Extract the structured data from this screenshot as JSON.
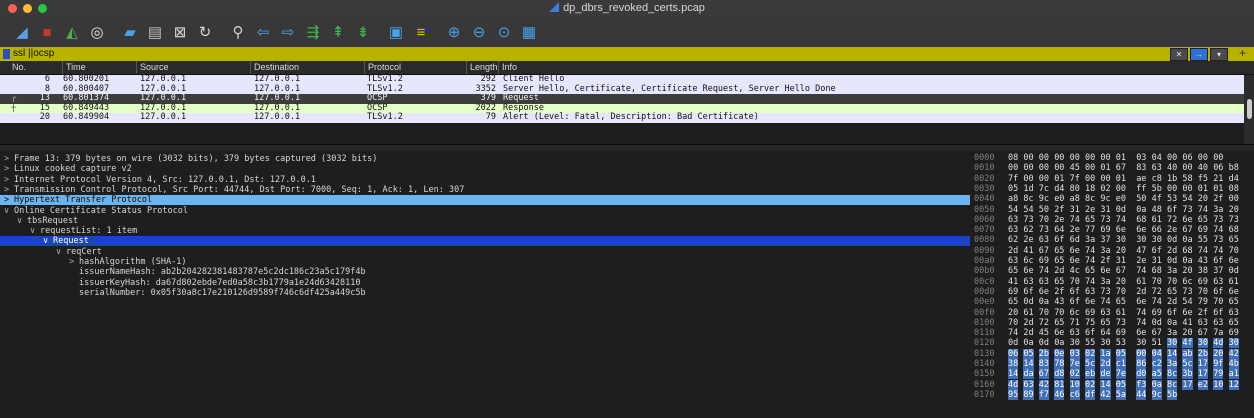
{
  "window": {
    "title": "dp_dbrs_revoked_certs.pcap",
    "light_colors": [
      "#ff5f57",
      "#febc2e",
      "#28c840"
    ]
  },
  "toolbar": {
    "icons": [
      {
        "name": "start-capture-icon",
        "glyph": "◢",
        "color": "#5aa0e8"
      },
      {
        "name": "stop-capture-icon",
        "glyph": "■",
        "color": "#c0392b"
      },
      {
        "name": "restart-capture-icon",
        "glyph": "◭",
        "color": "#4cae4c"
      },
      {
        "name": "capture-options-icon",
        "glyph": "◎",
        "color": "#e6e6e6"
      },
      {
        "name": "open-file-icon",
        "glyph": "▰",
        "color": "#4aa3e8"
      },
      {
        "name": "save-file-icon",
        "glyph": "▤",
        "color": "#bdbdbd"
      },
      {
        "name": "close-file-icon",
        "glyph": "⊠",
        "color": "#d8d8d8"
      },
      {
        "name": "reload-file-icon",
        "glyph": "↻",
        "color": "#d8d8d8"
      },
      {
        "name": "find-packet-icon",
        "glyph": "⚲",
        "color": "#d0d0d0"
      },
      {
        "name": "go-back-icon",
        "glyph": "⇦",
        "color": "#4aa3e8"
      },
      {
        "name": "go-forward-icon",
        "glyph": "⇨",
        "color": "#4aa3e8"
      },
      {
        "name": "go-to-packet-icon",
        "glyph": "⇶",
        "color": "#3fb950"
      },
      {
        "name": "go-first-packet-icon",
        "glyph": "⇞",
        "color": "#3fb950"
      },
      {
        "name": "go-last-packet-icon",
        "glyph": "⇟",
        "color": "#3fb950"
      },
      {
        "name": "autoscroll-icon",
        "glyph": "▣",
        "color": "#4aa3e8"
      },
      {
        "name": "colorize-icon",
        "glyph": "≡",
        "color": "#d7c400"
      },
      {
        "name": "zoom-in-icon",
        "glyph": "⊕",
        "color": "#4aa3e8"
      },
      {
        "name": "zoom-out-icon",
        "glyph": "⊖",
        "color": "#4aa3e8"
      },
      {
        "name": "normal-size-icon",
        "glyph": "⊙",
        "color": "#4aa3e8"
      },
      {
        "name": "resize-columns-icon",
        "glyph": "▦",
        "color": "#4aa3e8"
      }
    ]
  },
  "filter": {
    "value": "ssl ||ocsp",
    "bg_color": "#b7b100"
  },
  "packet_list": {
    "columns": [
      "No.",
      "Time",
      "Source",
      "Destination",
      "Protocol",
      "Length",
      "Info"
    ],
    "rows": [
      {
        "no": "6",
        "time": "60.800201",
        "source": "127.0.0.1",
        "destination": "127.0.0.1",
        "protocol": "TLSv1.2",
        "length": "292",
        "info": "Client Hello",
        "bg": "#e7e6ff",
        "selected": false,
        "marker": ""
      },
      {
        "no": "8",
        "time": "60.800407",
        "source": "127.0.0.1",
        "destination": "127.0.0.1",
        "protocol": "TLSv1.2",
        "length": "3352",
        "info": "Server Hello, Certificate, Certificate Request, Server Hello Done",
        "bg": "#e7e6ff",
        "selected": false,
        "marker": ""
      },
      {
        "no": "13",
        "time": "60.801374",
        "source": "127.0.0.1",
        "destination": "127.0.0.1",
        "protocol": "OCSP",
        "length": "379",
        "info": "Request",
        "bg": "#3d3d3d",
        "selected": true,
        "marker": "┌"
      },
      {
        "no": "15",
        "time": "60.849443",
        "source": "127.0.0.1",
        "destination": "127.0.0.1",
        "protocol": "OCSP",
        "length": "2022",
        "info": "Response",
        "bg": "#e4ffc7",
        "selected": false,
        "marker": "┼"
      },
      {
        "no": "20",
        "time": "60.849904",
        "source": "127.0.0.1",
        "destination": "127.0.0.1",
        "protocol": "TLSv1.2",
        "length": "79",
        "info": "Alert (Level: Fatal, Description: Bad Certificate)",
        "bg": "#e7e6ff",
        "selected": false,
        "marker": ""
      }
    ]
  },
  "details": [
    {
      "indent": 0,
      "arrow": ">",
      "text": "Frame 13: 379 bytes on wire (3032 bits), 379 bytes captured (3032 bits)",
      "hl": ""
    },
    {
      "indent": 0,
      "arrow": ">",
      "text": "Linux cooked capture v2",
      "hl": ""
    },
    {
      "indent": 0,
      "arrow": ">",
      "text": "Internet Protocol Version 4, Src: 127.0.0.1, Dst: 127.0.0.1",
      "hl": ""
    },
    {
      "indent": 0,
      "arrow": ">",
      "text": "Transmission Control Protocol, Src Port: 44744, Dst Port: 7000, Seq: 1, Ack: 1, Len: 307",
      "hl": ""
    },
    {
      "indent": 0,
      "arrow": ">",
      "text": "Hypertext Transfer Protocol",
      "hl": "light"
    },
    {
      "indent": 0,
      "arrow": "∨",
      "text": "Online Certificate Status Protocol",
      "hl": ""
    },
    {
      "indent": 1,
      "arrow": "∨",
      "text": "tbsRequest",
      "hl": ""
    },
    {
      "indent": 2,
      "arrow": "∨",
      "text": "requestList: 1 item",
      "hl": ""
    },
    {
      "indent": 3,
      "arrow": "∨",
      "text": "Request",
      "hl": "dark"
    },
    {
      "indent": 4,
      "arrow": "∨",
      "text": "reqCert",
      "hl": ""
    },
    {
      "indent": 5,
      "arrow": ">",
      "text": "hashAlgorithm (SHA-1)",
      "hl": ""
    },
    {
      "indent": 5,
      "arrow": "",
      "text": "issuerNameHash: ab2b204282381483787e5c2dc186c23a5c179f4b",
      "hl": ""
    },
    {
      "indent": 5,
      "arrow": "",
      "text": "issuerKeyHash: da67d802ebde7ed0a58c3b1779a1e24d63428110",
      "hl": ""
    },
    {
      "indent": 5,
      "arrow": "",
      "text": "serialNumber: 0x05f30a8c17e210126d9589f746c6df425a449c5b",
      "hl": ""
    }
  ],
  "hex_dump": [
    {
      "offset": "0000",
      "bytes": "08 00 00 00 00 00 00 01 03 04 00 06 00 00",
      "hl_from": -1,
      "hl_to": -1
    },
    {
      "offset": "0010",
      "bytes": "00 00 00 00 45 00 01 67 83 63 40 00 40 06 b8",
      "hl_from": -1,
      "hl_to": -1
    },
    {
      "offset": "0020",
      "bytes": "7f 00 00 01 7f 00 00 01 ae c8 1b 58 f5 21 d4",
      "hl_from": -1,
      "hl_to": -1
    },
    {
      "offset": "0030",
      "bytes": "05 1d 7c d4 80 18 02 00 ff 5b 00 00 01 01 08",
      "hl_from": -1,
      "hl_to": -1
    },
    {
      "offset": "0040",
      "bytes": "a8 8c 9c e0 a8 8c 9c e0 50 4f 53 54 20 2f 00",
      "hl_from": -1,
      "hl_to": -1
    },
    {
      "offset": "0050",
      "bytes": "54 54 50 2f 31 2e 31 0d 0a 48 6f 73 74 3a 20",
      "hl_from": -1,
      "hl_to": -1
    },
    {
      "offset": "0060",
      "bytes": "63 73 70 2e 74 65 73 74 68 61 72 6e 65 73 73",
      "hl_from": -1,
      "hl_to": -1
    },
    {
      "offset": "0070",
      "bytes": "63 62 73 64 2e 77 69 6e 6e 66 2e 67 69 74 68",
      "hl_from": -1,
      "hl_to": -1
    },
    {
      "offset": "0080",
      "bytes": "62 2e 63 6f 6d 3a 37 30 30 30 0d 0a 55 73 65",
      "hl_from": -1,
      "hl_to": -1
    },
    {
      "offset": "0090",
      "bytes": "2d 41 67 65 6e 74 3a 20 47 6f 2d 68 74 74 70",
      "hl_from": -1,
      "hl_to": -1
    },
    {
      "offset": "00a0",
      "bytes": "63 6c 69 65 6e 74 2f 31 2e 31 0d 0a 43 6f 6e",
      "hl_from": -1,
      "hl_to": -1
    },
    {
      "offset": "00b0",
      "bytes": "65 6e 74 2d 4c 65 6e 67 74 68 3a 20 38 37 0d",
      "hl_from": -1,
      "hl_to": -1
    },
    {
      "offset": "00c0",
      "bytes": "41 63 63 65 70 74 3a 20 61 70 70 6c 69 63 61",
      "hl_from": -1,
      "hl_to": -1
    },
    {
      "offset": "00d0",
      "bytes": "69 6f 6e 2f 6f 63 73 70 2d 72 65 73 70 6f 6e",
      "hl_from": -1,
      "hl_to": -1
    },
    {
      "offset": "00e0",
      "bytes": "65 0d 0a 43 6f 6e 74 65 6e 74 2d 54 79 70 65",
      "hl_from": -1,
      "hl_to": -1
    },
    {
      "offset": "00f0",
      "bytes": "20 61 70 70 6c 69 63 61 74 69 6f 6e 2f 6f 63",
      "hl_from": -1,
      "hl_to": -1
    },
    {
      "offset": "0100",
      "bytes": "70 2d 72 65 71 75 65 73 74 0d 0a 41 63 63 65",
      "hl_from": -1,
      "hl_to": -1
    },
    {
      "offset": "0110",
      "bytes": "74 2d 45 6e 63 6f 64 69 6e 67 3a 20 67 7a 69",
      "hl_from": -1,
      "hl_to": -1
    },
    {
      "offset": "0120",
      "bytes": "0d 0a 0d 0a 30 55 30 53 30 51 30 4f 30 4d 30",
      "hl_from": 10,
      "hl_to": 14
    },
    {
      "offset": "0130",
      "bytes": "06 05 2b 0e 03 02 1a 05 00 04 14 ab 2b 20 42",
      "hl_from": 0,
      "hl_to": 14
    },
    {
      "offset": "0140",
      "bytes": "38 14 83 78 7e 5c 2d c1 86 c2 3a 5c 17 9f 4b",
      "hl_from": 0,
      "hl_to": 14
    },
    {
      "offset": "0150",
      "bytes": "14 da 67 d8 02 eb de 7e d0 a5 8c 3b 17 79 a1",
      "hl_from": 0,
      "hl_to": 14
    },
    {
      "offset": "0160",
      "bytes": "4d 63 42 81 10 02 14 05 f3 0a 8c 17 e2 10 12",
      "hl_from": 0,
      "hl_to": 14
    },
    {
      "offset": "0170",
      "bytes": "95 89 f7 46 c6 df 42 5a 44 9c 5b",
      "hl_from": 0,
      "hl_to": 10
    }
  ]
}
